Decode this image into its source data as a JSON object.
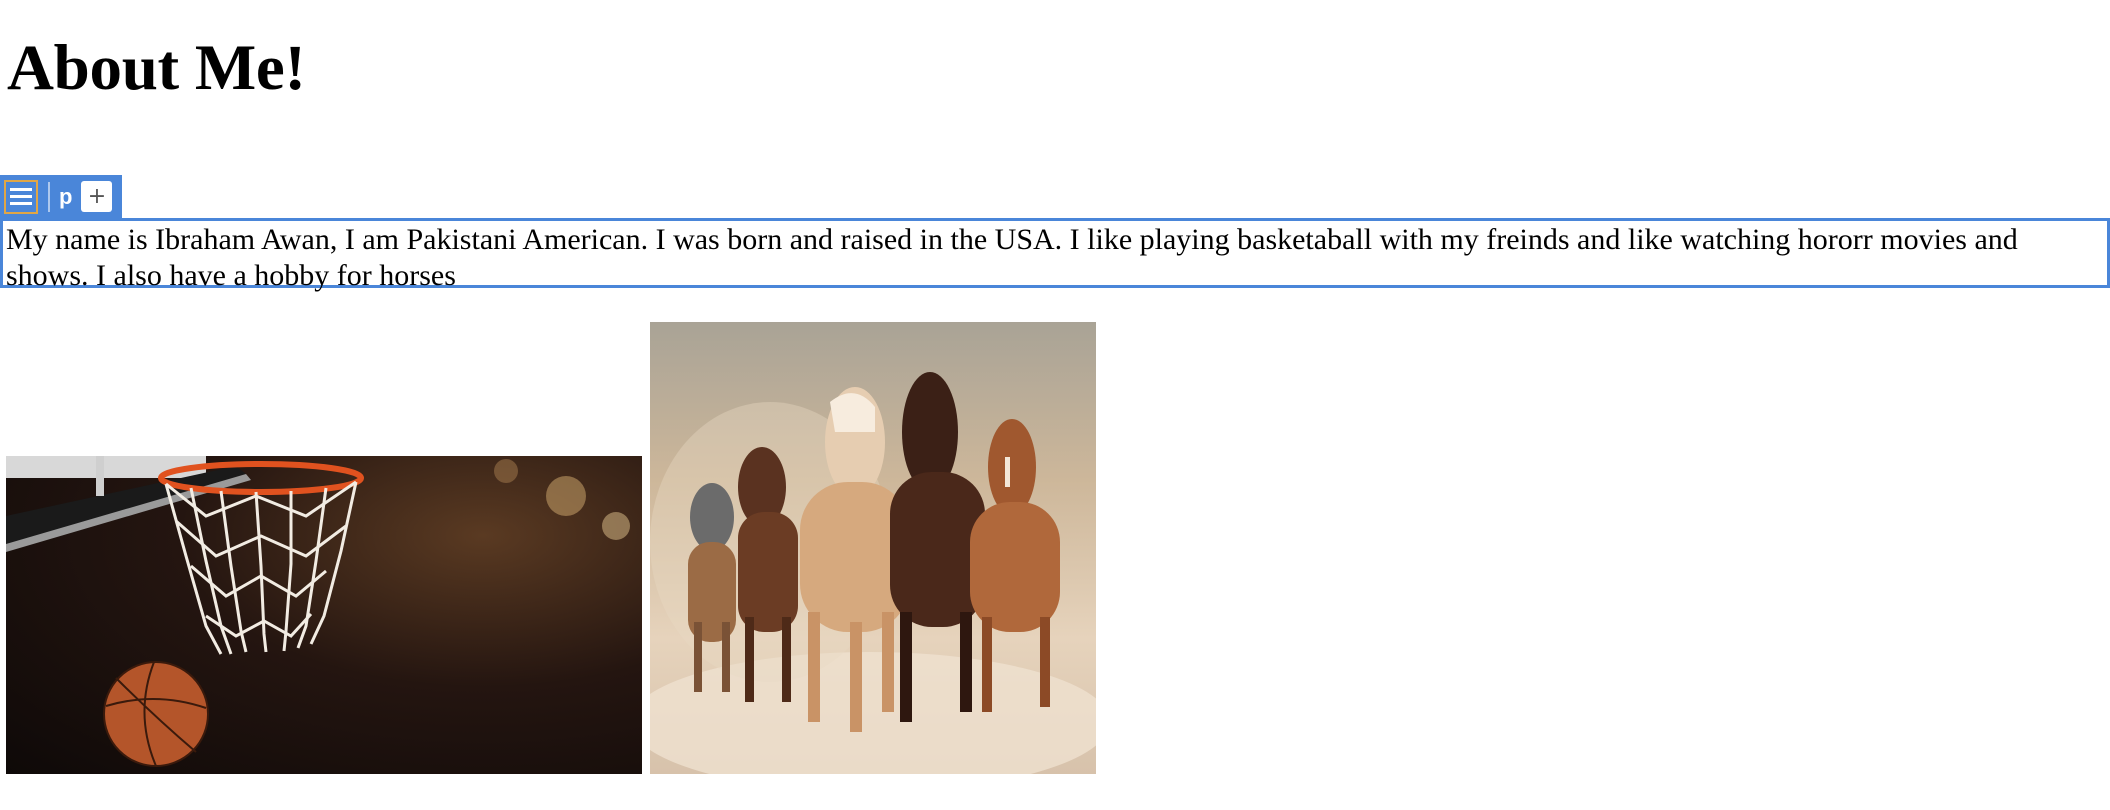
{
  "page": {
    "title": "About Me!"
  },
  "editor_toolbar": {
    "block_tag": "p",
    "add_symbol": "+",
    "menu_icon": "hamburger-menu-icon",
    "accent_color": "#4a86d9",
    "menu_border_color": "#e0a646"
  },
  "paragraph": {
    "text": "My name is Ibraham Awan, I am Pakistani American. I was born and raised in the USA. I like playing basketaball with my freinds and like watching hororr movies and shows. I also have a hobby for horses"
  },
  "images": [
    {
      "subject": "basketball-going-through-hoop"
    },
    {
      "subject": "horses-running"
    }
  ]
}
